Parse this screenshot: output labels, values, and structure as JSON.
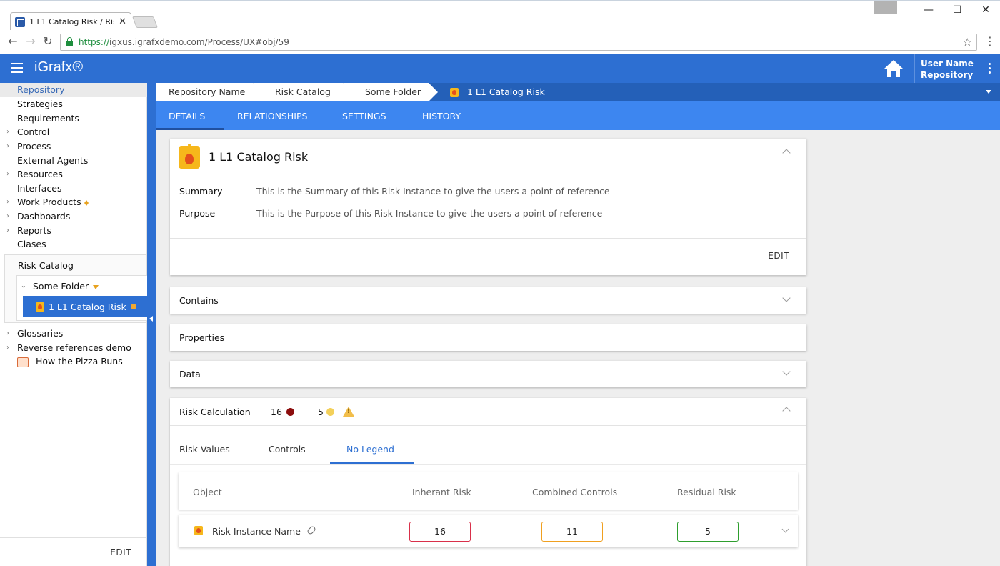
{
  "browser": {
    "tab_title": "1 L1 Catalog Risk / Risk /",
    "tab_close": "✕",
    "url_secure": "https://",
    "url_rest": "igxus.igrafxdemo.com/Process/UX#obj/59",
    "win_minimize": "—",
    "win_maximize": "☐",
    "win_close": "✕"
  },
  "header": {
    "logo": "iGrafx®",
    "user_name": "User Name",
    "user_repo": "Repository"
  },
  "sidebar": {
    "top": "Repository",
    "items": [
      {
        "label": "Strategies",
        "caret": false
      },
      {
        "label": "Requirements",
        "caret": false
      },
      {
        "label": "Control",
        "caret": true
      },
      {
        "label": "Process",
        "caret": true
      },
      {
        "label": "External Agents",
        "caret": false
      },
      {
        "label": "Resources",
        "caret": true
      },
      {
        "label": "Interfaces",
        "caret": false
      },
      {
        "label": "Work Products",
        "caret": true
      },
      {
        "label": "Dashboards",
        "caret": true
      },
      {
        "label": "Reports",
        "caret": true
      },
      {
        "label": "Clases",
        "caret": false
      }
    ],
    "risk_catalog": "Risk Catalog",
    "folder": "Some Folder",
    "selected": "1 L1 Catalog Risk",
    "after_items": [
      {
        "label": "Glossaries"
      },
      {
        "label": "Reverse references demo"
      },
      {
        "label": "How the Pizza Runs"
      }
    ],
    "edit": "EDIT"
  },
  "breadcrumb": {
    "items": [
      "Repository Name",
      "Risk Catalog",
      "Some Folder"
    ],
    "current": "1 L1 Catalog Risk"
  },
  "tabs": [
    "DETAILS",
    "RELATIONSHIPS",
    "SETTINGS",
    "HISTORY"
  ],
  "details": {
    "title": "1 L1 Catalog Risk",
    "summary_label": "Summary",
    "summary_value": "This is the Summary of this Risk Instance to give the users a point of reference",
    "purpose_label": "Purpose",
    "purpose_value": "This is the Purpose of this Risk Instance to give the users a point of reference",
    "edit": "EDIT"
  },
  "sections": {
    "contains": "Contains",
    "properties": "Properties",
    "data": "Data"
  },
  "risk_calc": {
    "title": "Risk Calculation",
    "value_red": "16",
    "value_yellow": "5",
    "subtabs": [
      "Risk Values",
      "Controls",
      "No Legend"
    ],
    "columns": [
      "Object",
      "Inherant Risk",
      "Combined Controls",
      "Residual Risk"
    ],
    "row": {
      "name": "Risk Instance Name",
      "inherent": "16",
      "combined": "11",
      "residual": "5"
    }
  },
  "colors": {
    "brand_blue": "#2d6fd2",
    "tab_blue": "#3d86f0",
    "inherent_border": "#d9304a",
    "combined_border": "#f0a020",
    "residual_border": "#2e9e2e"
  }
}
